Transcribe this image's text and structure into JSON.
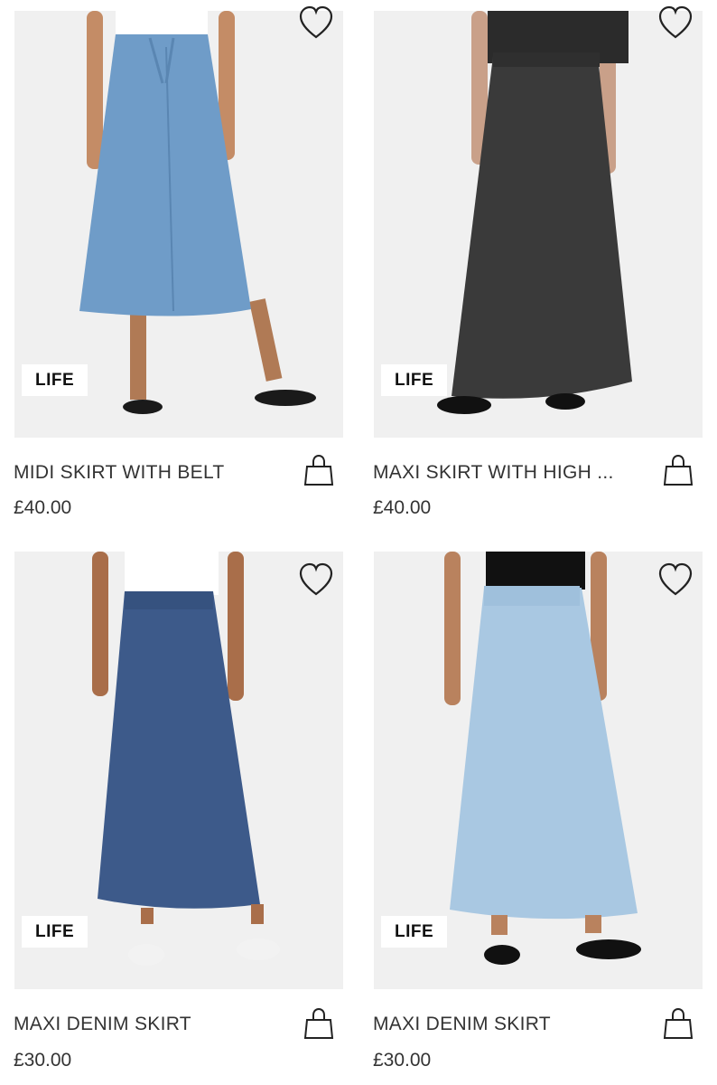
{
  "products": [
    {
      "badge": "LIFE",
      "title": "MIDI SKIRT WITH BELT",
      "price": "£40.00",
      "skirt_color": "#6f9cc8",
      "top_color": "#ffffff",
      "shoe_color": "#1a1a1a"
    },
    {
      "badge": "LIFE",
      "title": "MAXI SKIRT WITH HIGH ...",
      "price": "£40.00",
      "skirt_color": "#3a3a3a",
      "top_color": "#2b2b2b",
      "shoe_color": "#111111"
    },
    {
      "badge": "LIFE",
      "title": "MAXI DENIM SKIRT",
      "price": "£30.00",
      "skirt_color": "#3d5a8a",
      "top_color": "#ffffff",
      "shoe_color": "#f2f2f2"
    },
    {
      "badge": "LIFE",
      "title": "MAXI DENIM SKIRT",
      "price": "£30.00",
      "skirt_color": "#a9c8e2",
      "top_color": "#111111",
      "shoe_color": "#111111"
    }
  ],
  "icons": {
    "favorite": "heart-icon",
    "add_to_bag": "shopping-bag-icon"
  }
}
